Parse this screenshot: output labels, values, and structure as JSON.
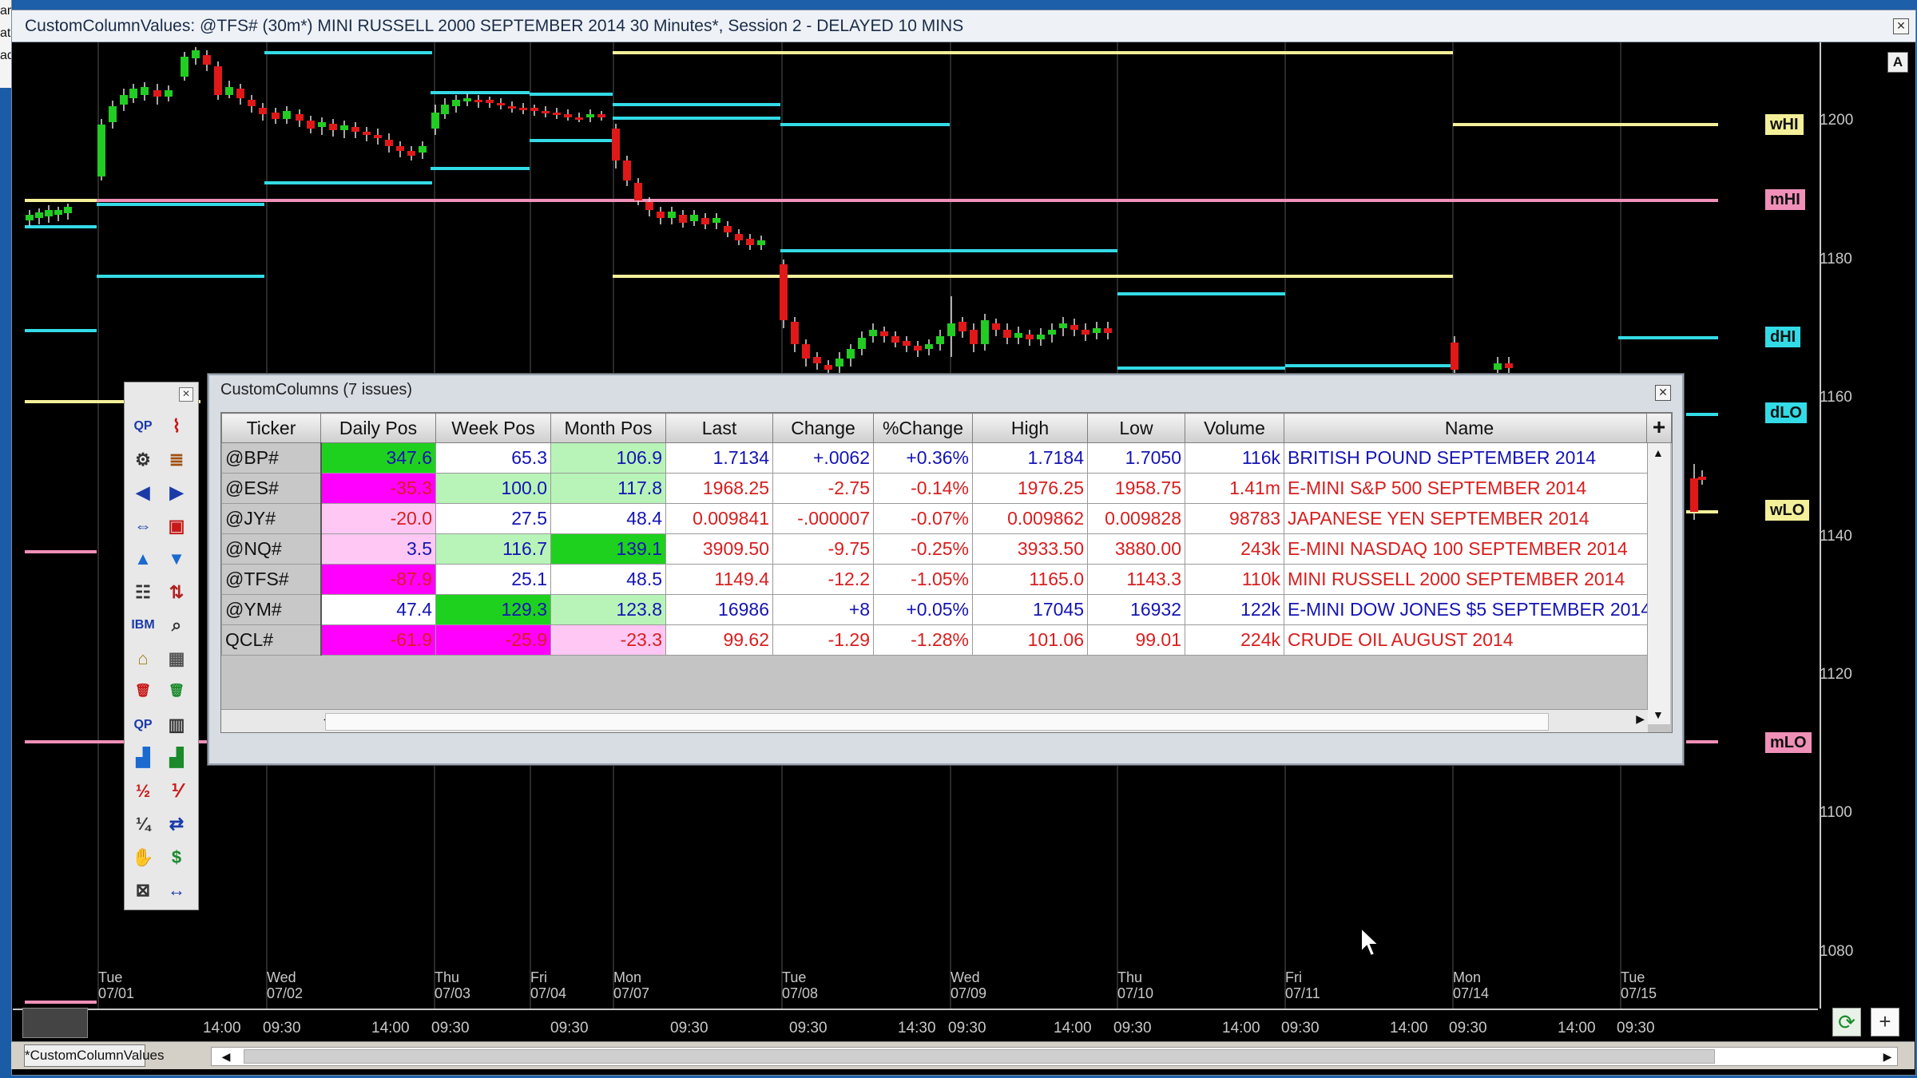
{
  "left_stub": {
    "lines": [
      "ar",
      "at",
      "ad"
    ]
  },
  "window": {
    "title": "CustomColumnValues: @TFS# (30m*) MINI RUSSELL 2000 SEPTEMBER 2014 30 Minutes*, Session 2 - DELAYED 10 MINS"
  },
  "chart": {
    "autoscale_label": "A",
    "price_axis": [
      "1200",
      "1180",
      "1160",
      "1140",
      "1120",
      "1100",
      "1080"
    ],
    "level_tags": [
      {
        "label": "wHI",
        "color": "#f4f09a"
      },
      {
        "label": "mHI",
        "color": "#f090b8"
      },
      {
        "label": "dHI",
        "color": "#33dbe6"
      },
      {
        "label": "dLO",
        "color": "#33dbe6"
      },
      {
        "label": "wLO",
        "color": "#f4f09a"
      },
      {
        "label": "mLO",
        "color": "#f090b8"
      }
    ],
    "dates": [
      {
        "day": "Tue",
        "date": "07/01"
      },
      {
        "day": "Wed",
        "date": "07/02"
      },
      {
        "day": "Thu",
        "date": "07/03"
      },
      {
        "day": "Fri",
        "date": "07/04"
      },
      {
        "day": "Mon",
        "date": "07/07"
      },
      {
        "day": "Tue",
        "date": "07/08"
      },
      {
        "day": "Wed",
        "date": "07/09"
      },
      {
        "day": "Thu",
        "date": "07/10"
      },
      {
        "day": "Fri",
        "date": "07/11"
      },
      {
        "day": "Mon",
        "date": "07/14"
      },
      {
        "day": "Tue",
        "date": "07/15"
      }
    ],
    "times": [
      "14:00",
      "09:30",
      "14:00",
      "09:30",
      "09:30",
      "09:30",
      "09:30",
      "14:30",
      "09:30",
      "14:00",
      "09:30",
      "14:00",
      "09:30",
      "14:00",
      "09:30",
      "14:00",
      "09:30"
    ],
    "colors": {
      "up": "#22cc22",
      "down": "#e01818",
      "cyan": "#33dbe6",
      "yellow": "#f4f09a",
      "pink": "#f090b8"
    }
  },
  "bottom": {
    "tab_label": "*CustomColumnValues",
    "refresh_icon": "refresh-icon",
    "add_label": "+"
  },
  "toolbox": {
    "icons": [
      "quote-page-icon",
      "chart-icon",
      "gear-icon",
      "layers-icon",
      "left-arrow-icon",
      "right-arrow-icon",
      "expand-icon",
      "window-icon",
      "up-arrow-icon",
      "down-arrow-icon",
      "list-icon",
      "sort-icon",
      "ibm-icon",
      "search-icon",
      "bookmark-icon",
      "grid-icon",
      "trash-icon",
      "trash-green-icon",
      "quote-link-icon",
      "columns-icon",
      "bar-chart-icon",
      "bar-chart2-icon",
      "fraction-e-icon",
      "fraction-s-icon",
      "decimal-icon",
      "link-icon",
      "hand-icon",
      "money-icon",
      "close-box-icon",
      "resize-icon"
    ],
    "glyphs": [
      "QP",
      "⌇",
      "⚙",
      "≣",
      "◀",
      "▶",
      "⇔",
      "▣",
      "▲",
      "▼",
      "☷",
      "⇅",
      "IBM",
      "⌕",
      "⌂",
      "▦",
      "🗑",
      "🗑",
      "QP",
      "▥",
      "▟",
      "▟",
      "½",
      "⅟",
      "¼",
      "⇄",
      "✋",
      "$",
      "⊠",
      "↔"
    ]
  },
  "custom_columns": {
    "title": "CustomColumns (7 issues)",
    "headers": [
      "Ticker",
      "Daily Pos",
      "Week Pos",
      "Month Pos",
      "Last",
      "Change",
      "%Change",
      "High",
      "Low",
      "Volume",
      "Name"
    ],
    "add_column_label": "+",
    "rows": [
      {
        "ticker": "@BP#",
        "daily": "347.6",
        "week": "65.3",
        "month": "106.9",
        "last": "1.7134",
        "change": "+.0062",
        "pct": "+0.36%",
        "high": "1.7184",
        "low": "1.7050",
        "volume": "116k",
        "name": "BRITISH POUND SEPTEMBER 2014",
        "daily_bg": "#1fd11f",
        "week_bg": "#ffffff",
        "month_bg": "#b8f4b8",
        "neg": false
      },
      {
        "ticker": "@ES#",
        "daily": "-35.3",
        "week": "100.0",
        "month": "117.8",
        "last": "1968.25",
        "change": "-2.75",
        "pct": "-0.14%",
        "high": "1976.25",
        "low": "1958.75",
        "volume": "1.41m",
        "name": "E-MINI S&P 500 SEPTEMBER 2014",
        "daily_bg": "#ff00ff",
        "week_bg": "#b8f4b8",
        "month_bg": "#b8f4b8",
        "neg": true
      },
      {
        "ticker": "@JY#",
        "daily": "-20.0",
        "week": "27.5",
        "month": "48.4",
        "last": "0.009841",
        "change": "-.000007",
        "pct": "-0.07%",
        "high": "0.009862",
        "low": "0.009828",
        "volume": "98783",
        "name": "JAPANESE YEN SEPTEMBER 2014",
        "daily_bg": "#ffc8f4",
        "week_bg": "#ffffff",
        "month_bg": "#ffffff",
        "neg": true
      },
      {
        "ticker": "@NQ#",
        "daily": "3.5",
        "week": "116.7",
        "month": "139.1",
        "last": "3909.50",
        "change": "-9.75",
        "pct": "-0.25%",
        "high": "3933.50",
        "low": "3880.00",
        "volume": "243k",
        "name": "E-MINI NASDAQ 100 SEPTEMBER 2014",
        "daily_bg": "#ffc8f4",
        "week_bg": "#b8f4b8",
        "month_bg": "#1fd11f",
        "neg": true
      },
      {
        "ticker": "@TFS#",
        "daily": "-87.9",
        "week": "25.1",
        "month": "48.5",
        "last": "1149.4",
        "change": "-12.2",
        "pct": "-1.05%",
        "high": "1165.0",
        "low": "1143.3",
        "volume": "110k",
        "name": "MINI RUSSELL 2000 SEPTEMBER 2014",
        "daily_bg": "#ff00ff",
        "week_bg": "#ffffff",
        "month_bg": "#ffffff",
        "neg": true
      },
      {
        "ticker": "@YM#",
        "daily": "47.4",
        "week": "129.3",
        "month": "123.8",
        "last": "16986",
        "change": "+8",
        "pct": "+0.05%",
        "high": "17045",
        "low": "16932",
        "volume": "122k",
        "name": "E-MINI DOW JONES $5 SEPTEMBER 2014",
        "daily_bg": "#ffffff",
        "week_bg": "#1fd11f",
        "month_bg": "#b8f4b8",
        "neg": false
      },
      {
        "ticker": "QCL#",
        "daily": "-61.9",
        "week": "-25.9",
        "month": "-23.3",
        "last": "99.62",
        "change": "-1.29",
        "pct": "-1.28%",
        "high": "101.06",
        "low": "99.01",
        "volume": "224k",
        "name": "CRUDE OIL AUGUST 2014",
        "daily_bg": "#ff00ff",
        "week_bg": "#ff00ff",
        "month_bg": "#ffc8f4",
        "neg": true
      }
    ]
  }
}
